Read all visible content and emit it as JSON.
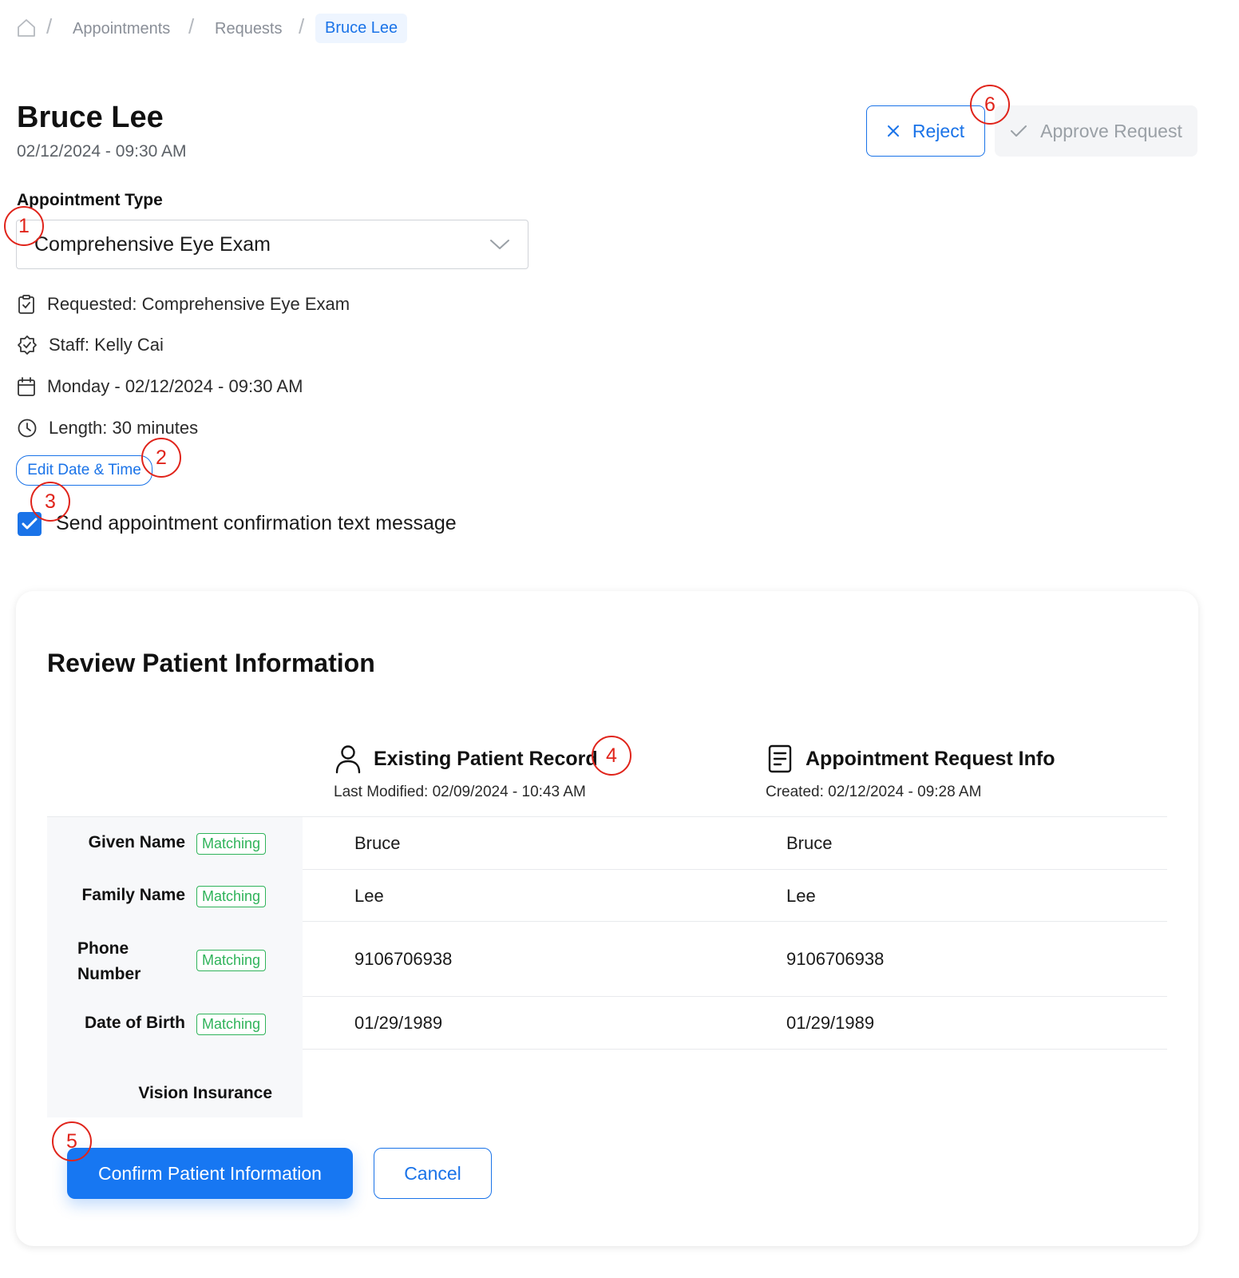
{
  "breadcrumb": {
    "home_icon": "home-icon",
    "items": [
      "Appointments",
      "Requests"
    ],
    "current": "Bruce Lee",
    "separator": "/"
  },
  "header": {
    "name": "Bruce Lee",
    "datetime": "02/12/2024 - 09:30 AM",
    "reject_label": "Reject",
    "approve_label": "Approve Request"
  },
  "appointment": {
    "type_label": "Appointment Type",
    "type_value": "Comprehensive Eye Exam",
    "details": [
      {
        "icon": "clipboard-check-icon",
        "text": "Requested: Comprehensive Eye Exam"
      },
      {
        "icon": "badge-check-icon",
        "text": "Staff: Kelly Cai"
      },
      {
        "icon": "calendar-icon",
        "text": "Monday - 02/12/2024 - 09:30 AM"
      },
      {
        "icon": "clock-icon",
        "text": "Length: 30 minutes"
      }
    ],
    "edit_label": "Edit Date & Time",
    "send_confirmation_label": "Send appointment confirmation text message",
    "send_confirmation_checked": true
  },
  "review": {
    "title": "Review Patient Information",
    "existing": {
      "title": "Existing Patient Record",
      "icon": "user-icon",
      "subtitle": "Last Modified: 02/09/2024 - 10:43 AM"
    },
    "request": {
      "title": "Appointment Request Info",
      "icon": "document-icon",
      "subtitle": "Created: 02/12/2024 - 09:28 AM"
    },
    "badge_label": "Matching",
    "rows": [
      {
        "label": "Given Name",
        "existing": "Bruce",
        "request": "Bruce"
      },
      {
        "label": "Family Name",
        "existing": "Lee",
        "request": "Lee"
      },
      {
        "label_line1": "Phone",
        "label_line2": "Number",
        "existing": "9106706938",
        "request": "9106706938"
      },
      {
        "label": "Date of Birth",
        "existing": "01/29/1989",
        "request": "01/29/1989"
      },
      {
        "label": "Vision Insurance",
        "existing": "",
        "request": ""
      }
    ],
    "confirm_label": "Confirm Patient Information",
    "cancel_label": "Cancel"
  },
  "callouts": [
    "1",
    "2",
    "3",
    "4",
    "5",
    "6"
  ],
  "colors": {
    "accent": "#1a73e8",
    "match_green": "#2fb35a",
    "callout_red": "#e0241b"
  }
}
